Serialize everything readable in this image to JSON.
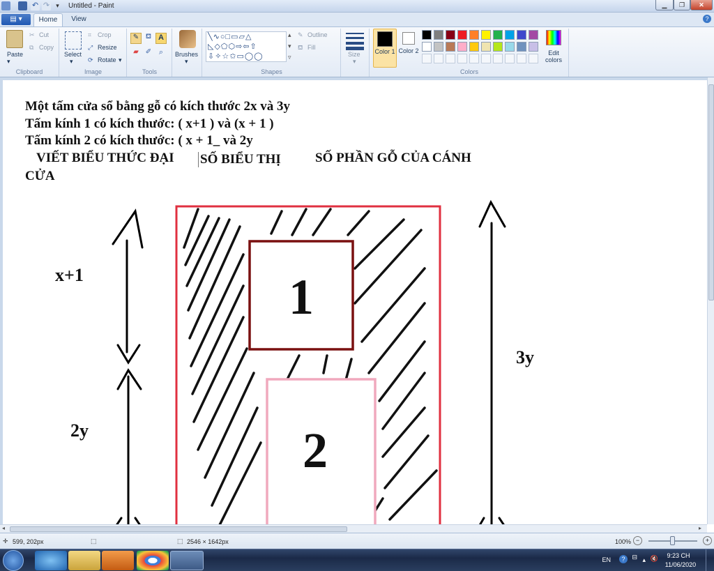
{
  "window": {
    "title": "Untitled - Paint"
  },
  "tabs": {
    "file": "",
    "home": "Home",
    "view": "View"
  },
  "ribbon": {
    "clipboard": {
      "paste": "Paste",
      "cut": "Cut",
      "copy": "Copy",
      "label": "Clipboard"
    },
    "image": {
      "select": "Select",
      "crop": "Crop",
      "resize": "Resize",
      "rotate": "Rotate",
      "label": "Image"
    },
    "tools": {
      "label": "Tools"
    },
    "brushes": {
      "label": "Brushes"
    },
    "shapes": {
      "outline": "Outline",
      "fill": "Fill",
      "label": "Shapes"
    },
    "size": {
      "label": "Size"
    },
    "colors": {
      "color1": "Color 1",
      "color2": "Color 2",
      "edit": "Edit colors",
      "label": "Colors",
      "color1_value": "#000000",
      "color2_value": "#ffffff",
      "palette_row1": [
        "#000000",
        "#7f7f7f",
        "#880015",
        "#ed1c24",
        "#ff7f27",
        "#fff200",
        "#22b14c",
        "#00a2e8",
        "#3f48cc",
        "#a349a4"
      ],
      "palette_row2": [
        "#ffffff",
        "#c3c3c3",
        "#b97a57",
        "#ffaec9",
        "#ffc90e",
        "#efe4b0",
        "#b5e61d",
        "#99d9ea",
        "#7092be",
        "#c8bfe7"
      ]
    }
  },
  "document": {
    "line1": "Một tấm cửa sổ bằng gỗ có kích thước 2x và 3y",
    "line2": "Tấm kính 1 có kích thước: ( x+1 ) và (x + 1 )",
    "line3": "Tấm kính 2 có kích thước: ( x + 1_ và 2y",
    "line4a": "VIẾT BIỂU THỨC ĐẠI ",
    "line4b": "SỐ BIỂU THỊ",
    "line4c": "SỐ PHẦN GỖ CỦA CÁNH",
    "line5": "CỬA",
    "label_x1": "x+1",
    "label_2y": "2y",
    "label_3y": "3y",
    "pane1": "1",
    "pane2": "2"
  },
  "status": {
    "cursor": "599, 202px",
    "size": "2546 × 1642px",
    "zoom": "100%"
  },
  "taskbar": {
    "lang": "EN",
    "time": "9:23 CH",
    "date": "11/06/2020"
  }
}
